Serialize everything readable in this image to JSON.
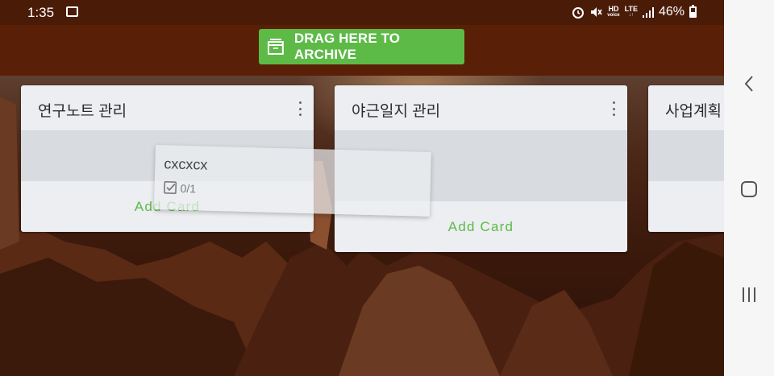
{
  "status": {
    "time": "1:35",
    "image_icon": "image-icon",
    "alarm_icon": "alarm-icon",
    "mute_icon": "mute-icon",
    "hd_top": "HD",
    "hd_bottom": "voice",
    "lte_top": "LTE",
    "lte_bottom": "↓↑",
    "signal_icon": "signal-icon",
    "battery_text": "46%",
    "battery_level": 0.46,
    "battery_icon": "battery-icon"
  },
  "archive": {
    "label": "DRAG HERE TO ARCHIVE",
    "icon": "archive-box-icon",
    "color": "#5dba47"
  },
  "lists": [
    {
      "title": "연구노트 관리",
      "add_label": "Add Card"
    },
    {
      "title": "야근일지 관리",
      "add_label": "Add Card"
    },
    {
      "title": "사업계획",
      "add_label": ""
    }
  ],
  "dragged_card": {
    "title": "cxcxcx",
    "checklist": "0/1"
  },
  "nav": {
    "back_icon": "back-chevron-icon",
    "home_icon": "home-icon",
    "recents_icon": "recents-icon"
  },
  "colors": {
    "accent_green": "#5dba47",
    "topbar_brown": "#5a1f07",
    "statusbar_brown": "#4a1c08"
  }
}
